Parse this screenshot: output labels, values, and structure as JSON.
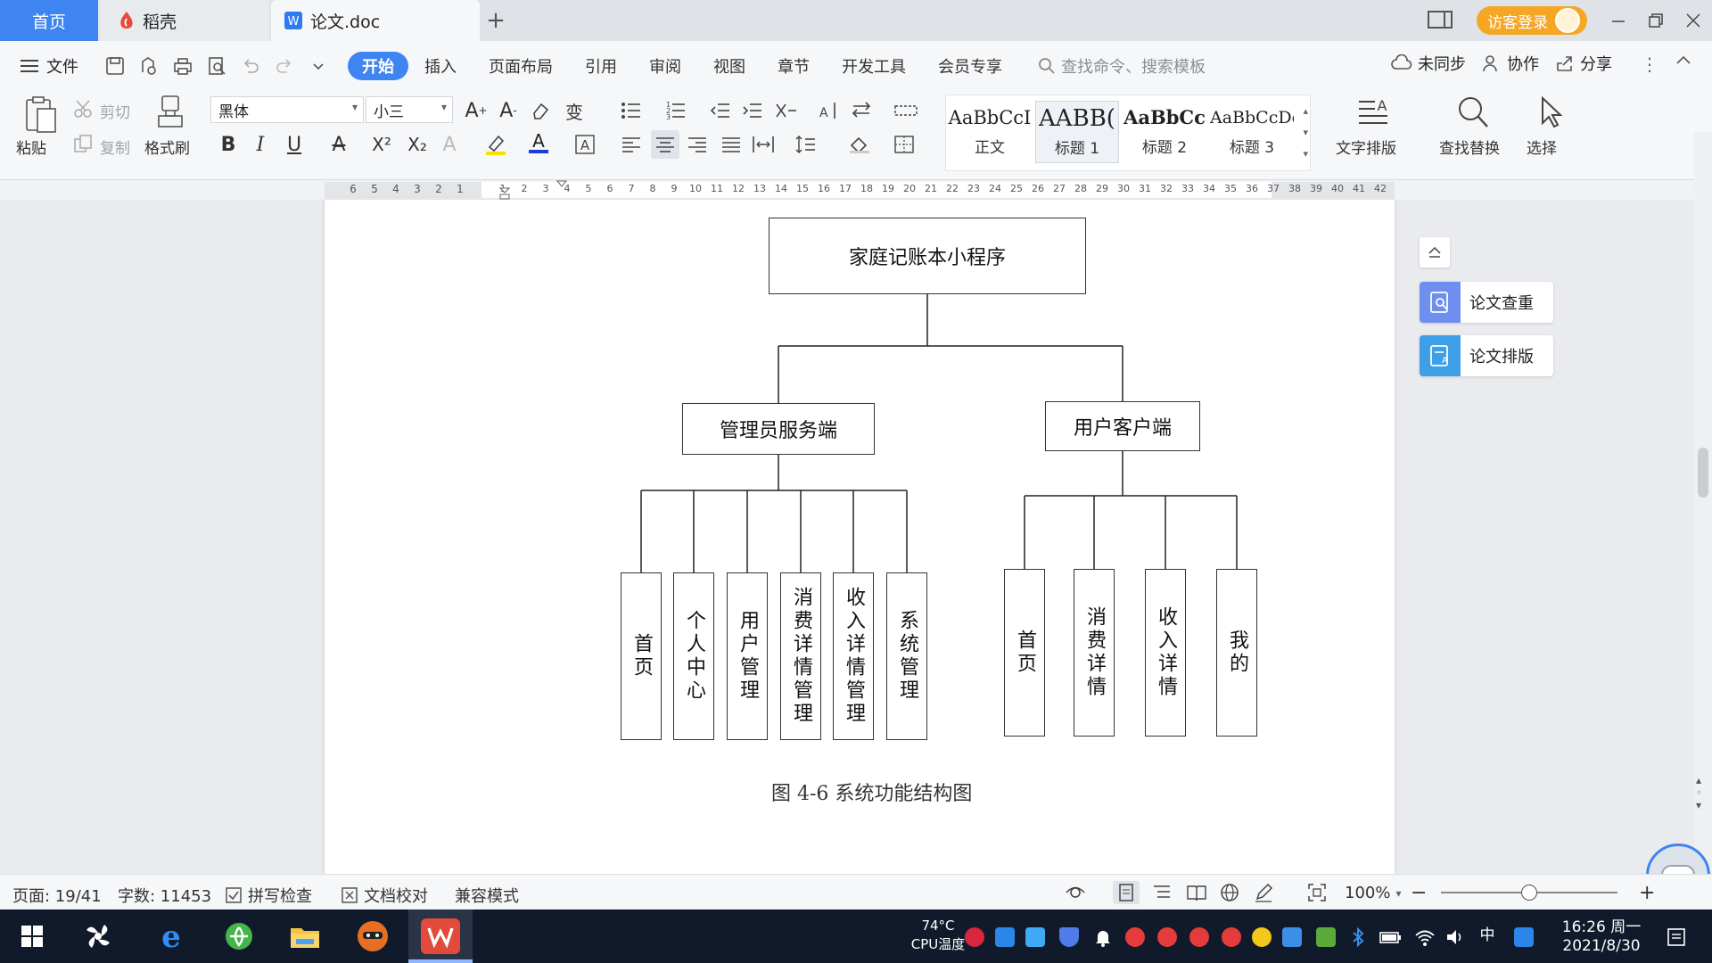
{
  "titlebar": {
    "tabs": [
      {
        "label": "首页"
      },
      {
        "label": "稻壳"
      },
      {
        "label": "论文.doc"
      }
    ],
    "add_tab": "+",
    "login_label": "访客登录"
  },
  "menubar": {
    "file_label": "文件",
    "items": [
      "开始",
      "插入",
      "页面布局",
      "引用",
      "审阅",
      "视图",
      "章节",
      "开发工具",
      "会员专享"
    ],
    "search_placeholder": "查找命令、搜索模板",
    "sync_label": "未同步",
    "collab_label": "协作",
    "share_label": "分享"
  },
  "ribbon": {
    "paste_label": "粘贴",
    "cut_label": "剪切",
    "copy_label": "复制",
    "format_painter_label": "格式刷",
    "font_name": "黑体",
    "font_size": "小三",
    "styles": [
      {
        "sample": "AaBbCcI",
        "name": "正文"
      },
      {
        "sample": "AABB(",
        "name": "标题 1"
      },
      {
        "sample": "AaBbCc",
        "name": "标题 2"
      },
      {
        "sample": "AaBbCcDc",
        "name": "标题 3"
      }
    ],
    "text_layout_label": "文字排版",
    "find_replace_label": "查找替换",
    "select_label": "选择"
  },
  "ruler": {
    "left_numbers": [
      "6",
      "5",
      "4",
      "3",
      "2",
      "1"
    ],
    "right_numbers": [
      "1",
      "2",
      "3",
      "4",
      "5",
      "6",
      "7",
      "8",
      "9",
      "10",
      "11",
      "12",
      "13",
      "14",
      "15",
      "16",
      "17",
      "18",
      "19",
      "20",
      "21",
      "22",
      "23",
      "24",
      "25",
      "26",
      "27",
      "28",
      "29",
      "30",
      "31",
      "32",
      "33",
      "34",
      "35",
      "36",
      "37",
      "38",
      "39",
      "40",
      "41",
      "42"
    ]
  },
  "diagram": {
    "root": "家庭记账本小程序",
    "admin": {
      "label": "管理员服务端",
      "children": [
        "首页",
        "个人中心",
        "用户管理",
        "消费详情管理",
        "收入详情管理",
        "系统管理"
      ]
    },
    "client": {
      "label": "用户客户端",
      "children": [
        "首页",
        "消费详情",
        "收入详情",
        "我的"
      ]
    },
    "caption": "图 4-6 系统功能结构图"
  },
  "side_panel": {
    "check_label": "论文查重",
    "layout_label": "论文排版"
  },
  "statusbar": {
    "page": "页面: 19/41",
    "words": "字数: 11453",
    "spell_check": "拼写检查",
    "doc_proof": "文档校对",
    "compat_mode": "兼容模式",
    "zoom": "100%",
    "zoom_level": 0.5
  },
  "taskbar": {
    "temp": "74°C",
    "temp_label": "CPU温度",
    "ime": "中",
    "time": "16:26 周一",
    "date": "2021/8/30"
  },
  "colors": {
    "accent": "#3f85f2",
    "login": "#f5a623",
    "taskbar": "#111a2b"
  }
}
